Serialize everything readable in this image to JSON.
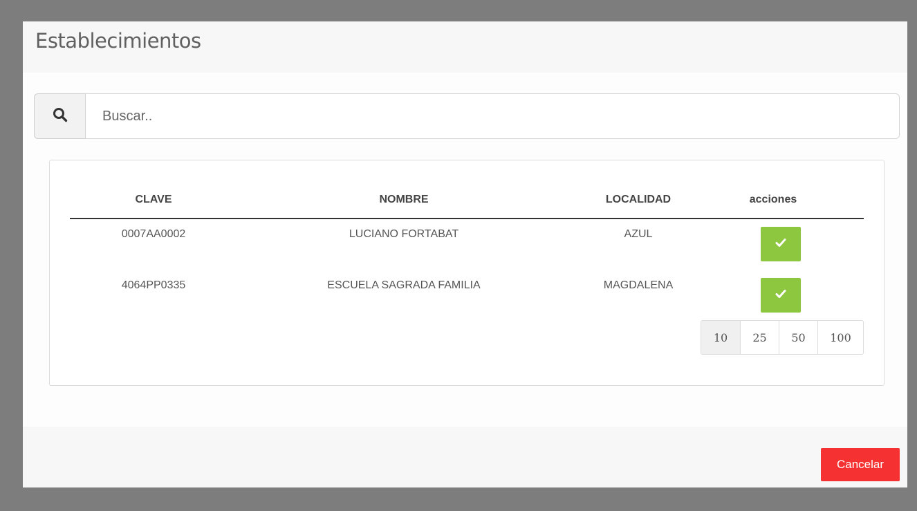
{
  "modal": {
    "title": "Establecimientos"
  },
  "search": {
    "placeholder": "Buscar..",
    "icon": "search-icon"
  },
  "table": {
    "headers": [
      "CLAVE",
      "NOMBRE",
      "LOCALIDAD",
      "acciones"
    ],
    "rows": [
      {
        "clave": "0007AA0002",
        "nombre": "LUCIANO FORTABAT",
        "localidad": "AZUL",
        "action_icon": "check-icon"
      },
      {
        "clave": "4064PP0335",
        "nombre": "ESCUELA SAGRADA FAMILIA",
        "localidad": "MAGDALENA",
        "action_icon": "check-icon"
      }
    ]
  },
  "pagination": {
    "options": [
      "10",
      "25",
      "50",
      "100"
    ],
    "selected": "10"
  },
  "footer": {
    "cancel_label": "Cancelar"
  },
  "colors": {
    "accent_green": "#8dc63f",
    "cancel_red": "#f53131",
    "backdrop": "#7d7d7d"
  }
}
